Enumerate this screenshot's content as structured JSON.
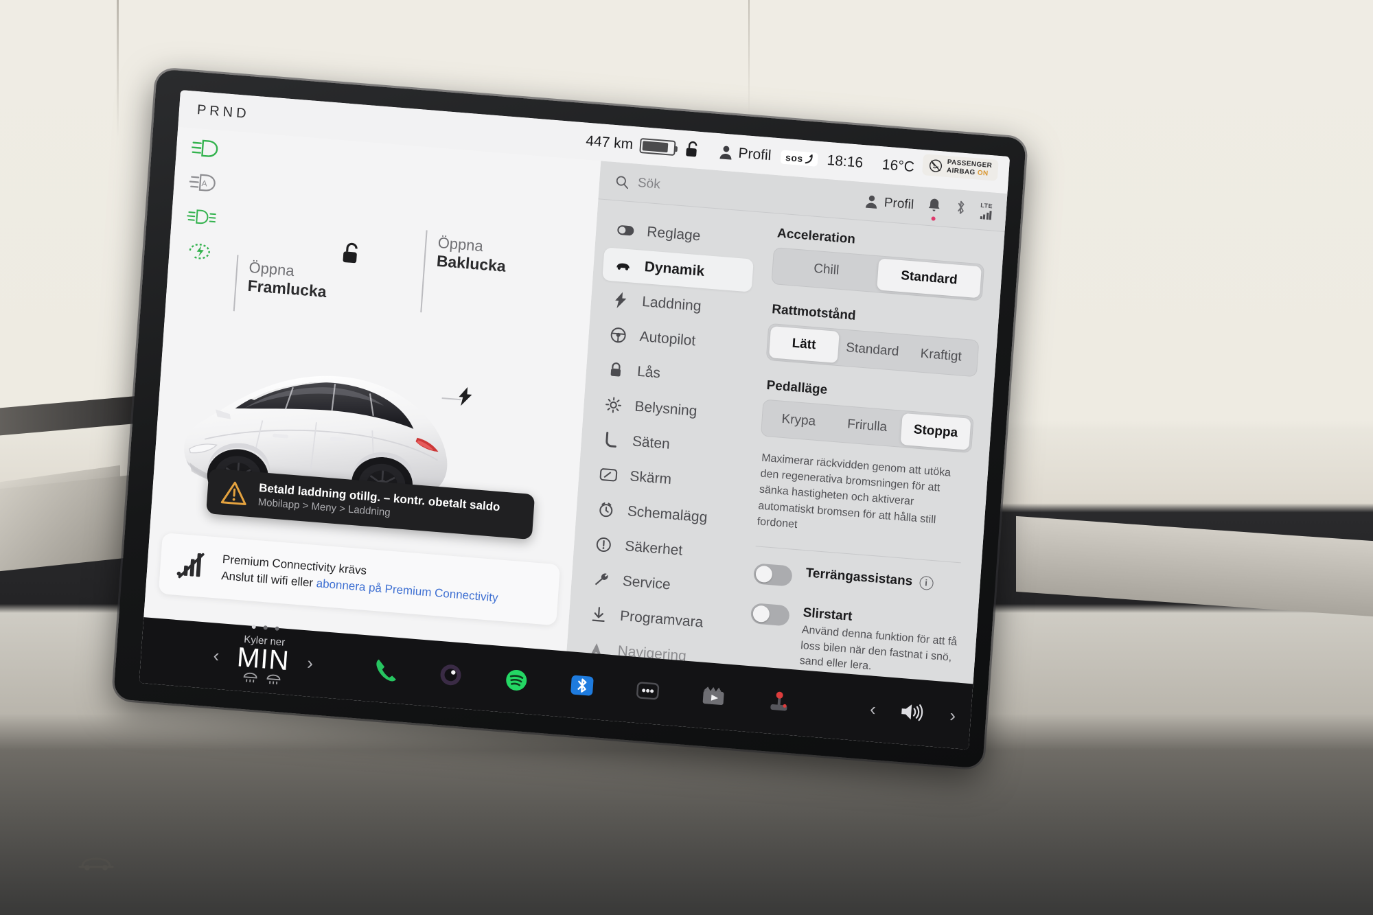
{
  "statusbar": {
    "prnd": "PRND",
    "range": "447 km",
    "lock_icon": "unlocked-padlock-icon",
    "profile_label": "Profil",
    "sos_label": "sos",
    "time": "18:16",
    "temperature": "16°C",
    "airbag_line1": "PASSENGER",
    "airbag_line2": "AIRBAG",
    "airbag_state": "ON"
  },
  "car_pane": {
    "indicators": [
      {
        "name": "low-beam-headlight-icon",
        "color": "#2fb24a"
      },
      {
        "name": "auto-highbeam-icon",
        "color": "#8d8d91"
      },
      {
        "name": "fog-light-icon",
        "color": "#2fb24a"
      },
      {
        "name": "regen-charge-icon",
        "color": "#2fb24a"
      }
    ],
    "front_trunk_label_line1": "Öppna",
    "front_trunk_label_line2": "Framlucka",
    "rear_trunk_label_line1": "Öppna",
    "rear_trunk_label_line2": "Baklucka",
    "toast": {
      "title": "Betald laddning otillg. – kontr. obetalt saldo",
      "subtitle": "Mobilapp > Meny > Laddning"
    },
    "connectivity_card": {
      "title": "Premium Connectivity krävs",
      "body_prefix": "Anslut till wifi eller ",
      "body_link": "abonnera på Premium Connectivity"
    }
  },
  "settings": {
    "search_placeholder": "Sök",
    "header_profile": "Profil",
    "network_label": "LTE",
    "menu": [
      {
        "label": "Reglage",
        "icon": "toggle-switch-icon",
        "active": false
      },
      {
        "label": "Dynamik",
        "icon": "car-side-icon",
        "active": true
      },
      {
        "label": "Laddning",
        "icon": "lightning-bolt-icon",
        "active": false
      },
      {
        "label": "Autopilot",
        "icon": "steering-wheel-icon",
        "active": false
      },
      {
        "label": "Lås",
        "icon": "padlock-icon",
        "active": false
      },
      {
        "label": "Belysning",
        "icon": "sun-brightness-icon",
        "active": false
      },
      {
        "label": "Säten",
        "icon": "seat-icon",
        "active": false
      },
      {
        "label": "Skärm",
        "icon": "display-screen-icon",
        "active": false
      },
      {
        "label": "Schemalägg",
        "icon": "clock-schedule-icon",
        "active": false
      },
      {
        "label": "Säkerhet",
        "icon": "exclamation-circle-icon",
        "active": false
      },
      {
        "label": "Service",
        "icon": "wrench-icon",
        "active": false
      },
      {
        "label": "Programvara",
        "icon": "download-arrow-icon",
        "active": false
      },
      {
        "label": "Navigering",
        "icon": "navigation-arrow-icon",
        "active": false
      }
    ],
    "groups": [
      {
        "title": "Acceleration",
        "options": [
          "Chill",
          "Standard"
        ],
        "selected": "Standard"
      },
      {
        "title": "Rattmotstånd",
        "options": [
          "Lätt",
          "Standard",
          "Kraftigt"
        ],
        "selected": "Lätt"
      },
      {
        "title": "Pedalläge",
        "options": [
          "Krypa",
          "Frirulla",
          "Stoppa"
        ],
        "selected": "Stoppa",
        "hint": "Maximerar räckvidden genom att utöka den regenerativa bromsningen för att sänka hastigheten och aktiverar automatiskt bromsen för att hålla still fordonet"
      }
    ],
    "toggles": [
      {
        "label": "Terrängassistans",
        "info_icon": "info-circle-icon",
        "description": "",
        "state": "off"
      },
      {
        "label": "Slirstart",
        "info_icon": "",
        "description": "Använd denna funktion för att få loss bilen när den fastnat i snö, sand eller lera.",
        "state": "off"
      }
    ]
  },
  "dock": {
    "climate_sub": "Kyler ner",
    "climate_value": "MIN",
    "prev_arrow": "‹",
    "next_arrow": "›",
    "page_dots": 3,
    "page_active": 0,
    "apps": [
      {
        "name": "phone-app-icon",
        "color": "#22c55e"
      },
      {
        "name": "camera-app-icon",
        "color": "#3a2a45"
      },
      {
        "name": "spotify-app-icon",
        "color": "#1ed760"
      },
      {
        "name": "bluetooth-app-icon",
        "color": "#1a7ae0"
      },
      {
        "name": "more-apps-icon",
        "color": "#2e2e31"
      },
      {
        "name": "theater-app-icon",
        "color": "#6e6e73"
      },
      {
        "name": "toybox-app-icon",
        "color": "#e03a3a"
      }
    ],
    "volume_icon": "speaker-volume-icon"
  },
  "colors": {
    "accent_green": "#2fb24a",
    "link_blue": "#3c6fd4",
    "notification_dot": "#e2376b",
    "warning_amber": "#e4a03a",
    "screen_bg": "#f2f2f3",
    "settings_bg": "#d9dadb"
  }
}
